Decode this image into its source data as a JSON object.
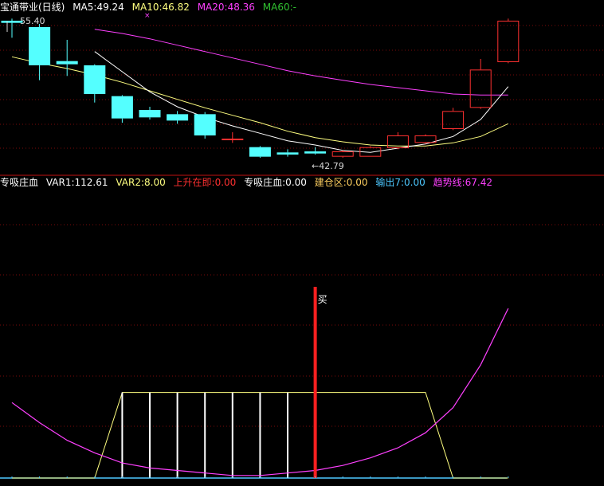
{
  "colors": {
    "background": "#000000",
    "grid": "#7a0a0a",
    "divider": "#c01010",
    "up": "#ff3030",
    "down": "#54ffff",
    "ma5": "#ffffff",
    "ma10": "#ffff80",
    "ma20": "#ff40ff",
    "ma60": "#30c030",
    "var1": "#ffffff",
    "var2": "#ffff80",
    "trend": "#ff40ff",
    "buy": "#ff2020",
    "baseline": "#4dc8ff",
    "zone": "#ffffff"
  },
  "top": {
    "title": "宝通带业(日线)",
    "ma5": "MA5:49.24",
    "ma10": "MA10:46.82",
    "ma20": "MA20:48.36",
    "ma60": "MA60:-",
    "max_label": "55.40",
    "min_label": "←42.79"
  },
  "bottom": {
    "title": "专吸庄血",
    "var1": "VAR1:112.61",
    "var2": "VAR2:8.00",
    "rise": "上升在即:0.00",
    "absorb": "专吸庄血:0.00",
    "build": "建仓区:0.00",
    "output": "输出7:0.00",
    "trend": "趋势线:67.42",
    "buy_label": "买"
  },
  "chart_data": [
    {
      "type": "candlestick",
      "title": "宝通带业(日线)",
      "candles": [
        {
          "o": 55.4,
          "h": 55.6,
          "l": 53.8,
          "c": 55.2,
          "dir": "down"
        },
        {
          "o": 54.8,
          "h": 55.1,
          "l": 49.8,
          "c": 51.2,
          "dir": "down"
        },
        {
          "o": 51.6,
          "h": 53.6,
          "l": 50.2,
          "c": 51.3,
          "dir": "down"
        },
        {
          "o": 51.2,
          "h": 51.3,
          "l": 47.7,
          "c": 48.5,
          "dir": "down"
        },
        {
          "o": 48.3,
          "h": 48.4,
          "l": 45.8,
          "c": 46.2,
          "dir": "down"
        },
        {
          "o": 47.0,
          "h": 47.3,
          "l": 46.1,
          "c": 46.3,
          "dir": "down"
        },
        {
          "o": 46.6,
          "h": 46.9,
          "l": 45.7,
          "c": 46.0,
          "dir": "down"
        },
        {
          "o": 46.6,
          "h": 46.8,
          "l": 44.3,
          "c": 44.6,
          "dir": "down"
        },
        {
          "o": 44.3,
          "h": 44.9,
          "l": 43.9,
          "c": 44.3,
          "dir": "up"
        },
        {
          "o": 43.5,
          "h": 43.6,
          "l": 42.5,
          "c": 42.6,
          "dir": "down"
        },
        {
          "o": 43.0,
          "h": 43.3,
          "l": 42.6,
          "c": 42.8,
          "dir": "down"
        },
        {
          "o": 43.1,
          "h": 43.5,
          "l": 42.8,
          "c": 42.9,
          "dir": "down"
        },
        {
          "o": 42.6,
          "h": 43.2,
          "l": 42.5,
          "c": 43.1,
          "dir": "up"
        },
        {
          "o": 42.6,
          "h": 43.6,
          "l": 42.6,
          "c": 43.5,
          "dir": "up"
        },
        {
          "o": 43.4,
          "h": 44.9,
          "l": 43.3,
          "c": 44.6,
          "dir": "up"
        },
        {
          "o": 43.9,
          "h": 44.7,
          "l": 43.8,
          "c": 44.6,
          "dir": "up"
        },
        {
          "o": 45.2,
          "h": 47.2,
          "l": 45.1,
          "c": 46.9,
          "dir": "up"
        },
        {
          "o": 47.2,
          "h": 51.8,
          "l": 47.1,
          "c": 50.8,
          "dir": "up"
        },
        {
          "o": 51.5,
          "h": 55.6,
          "l": 51.4,
          "c": 55.4,
          "dir": "up"
        }
      ],
      "ma5": [
        null,
        null,
        null,
        52.5,
        50.6,
        48.7,
        47.3,
        46.3,
        45.5,
        44.8,
        44.1,
        43.7,
        43.2,
        43.0,
        43.4,
        43.8,
        44.5,
        46.1,
        49.2
      ],
      "ma10": [
        52.0,
        51.4,
        50.9,
        50.3,
        49.6,
        48.8,
        48.0,
        47.2,
        46.5,
        45.8,
        45.0,
        44.4,
        44.0,
        43.7,
        43.6,
        43.6,
        43.9,
        44.5,
        45.7
      ],
      "ma20": [
        null,
        null,
        null,
        54.6,
        54.2,
        53.7,
        53.1,
        52.5,
        51.9,
        51.3,
        50.7,
        50.2,
        49.8,
        49.4,
        49.1,
        48.8,
        48.5,
        48.4,
        48.4
      ],
      "ylim": [
        41.6,
        56.3
      ]
    },
    {
      "type": "indicator",
      "title": "专吸庄血",
      "trend_line": [
        30,
        22,
        15,
        10,
        6,
        4,
        3,
        2,
        1,
        1,
        2,
        3,
        5,
        8,
        12,
        18,
        28,
        45,
        67.42
      ],
      "build_zone": [
        0,
        0,
        0,
        0,
        34,
        34,
        34,
        34,
        34,
        34,
        34,
        34,
        34,
        34,
        34,
        34,
        0,
        0,
        0
      ],
      "build_zone_bars": [
        4,
        5,
        6,
        7,
        8,
        9,
        10
      ],
      "buy_signal_index": 11,
      "ylim": [
        0,
        76
      ]
    }
  ]
}
